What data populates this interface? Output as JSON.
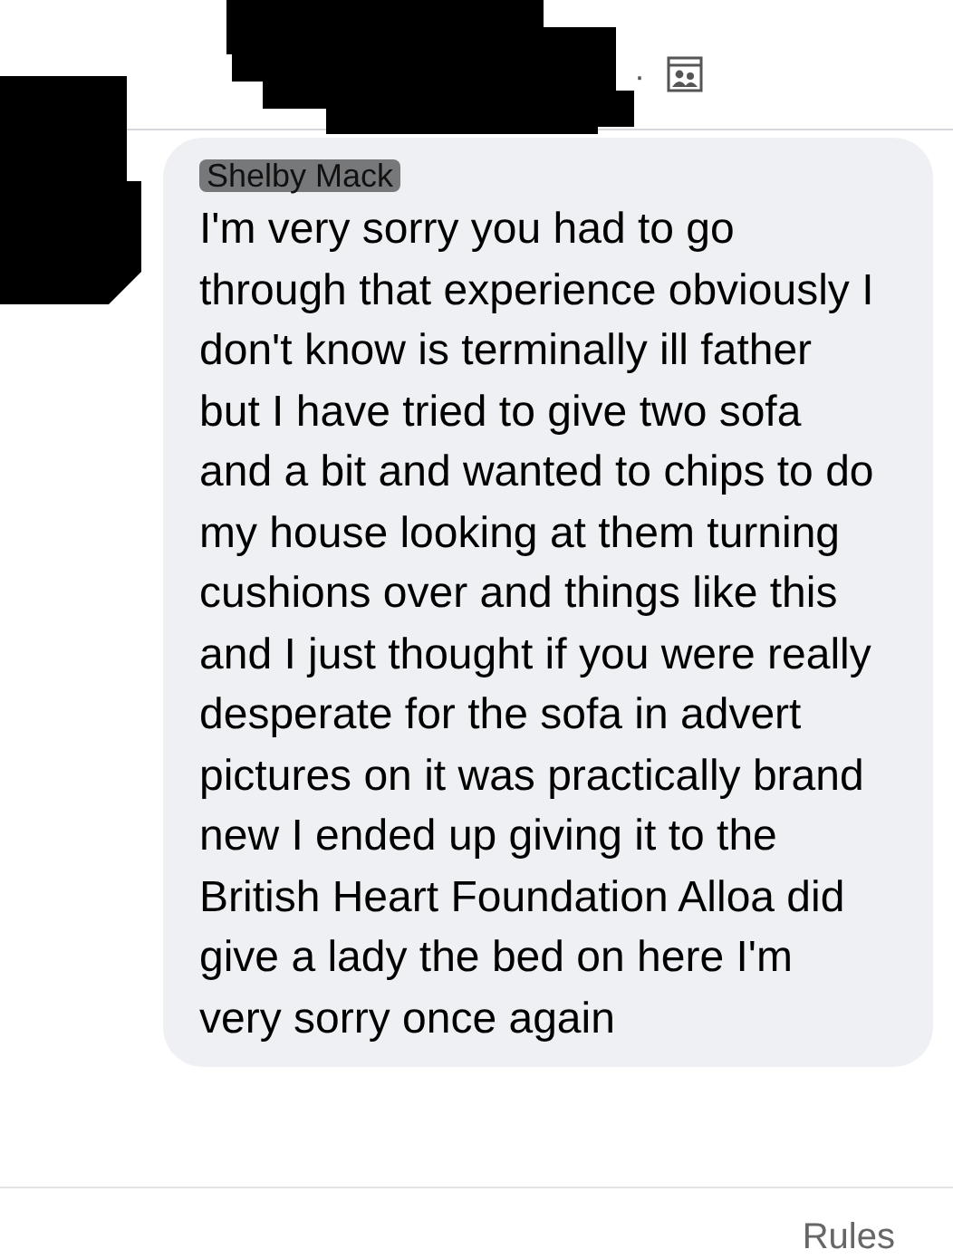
{
  "header": {
    "separator": "·"
  },
  "comment": {
    "author": "Shelby Mack",
    "text": "I'm very sorry you had to go through that experience obviously I don't know is terminally ill father but I have tried to give two sofa and a bit and wanted to chips to do my house looking at them turning cushions over and things like this and I just thought if you were really desperate for the sofa in advert pictures on it was practically brand new I ended up giving it to the British Heart Foundation Alloa did give a lady the bed on here I'm very sorry once again"
  },
  "footer": {
    "link": "Rules"
  }
}
